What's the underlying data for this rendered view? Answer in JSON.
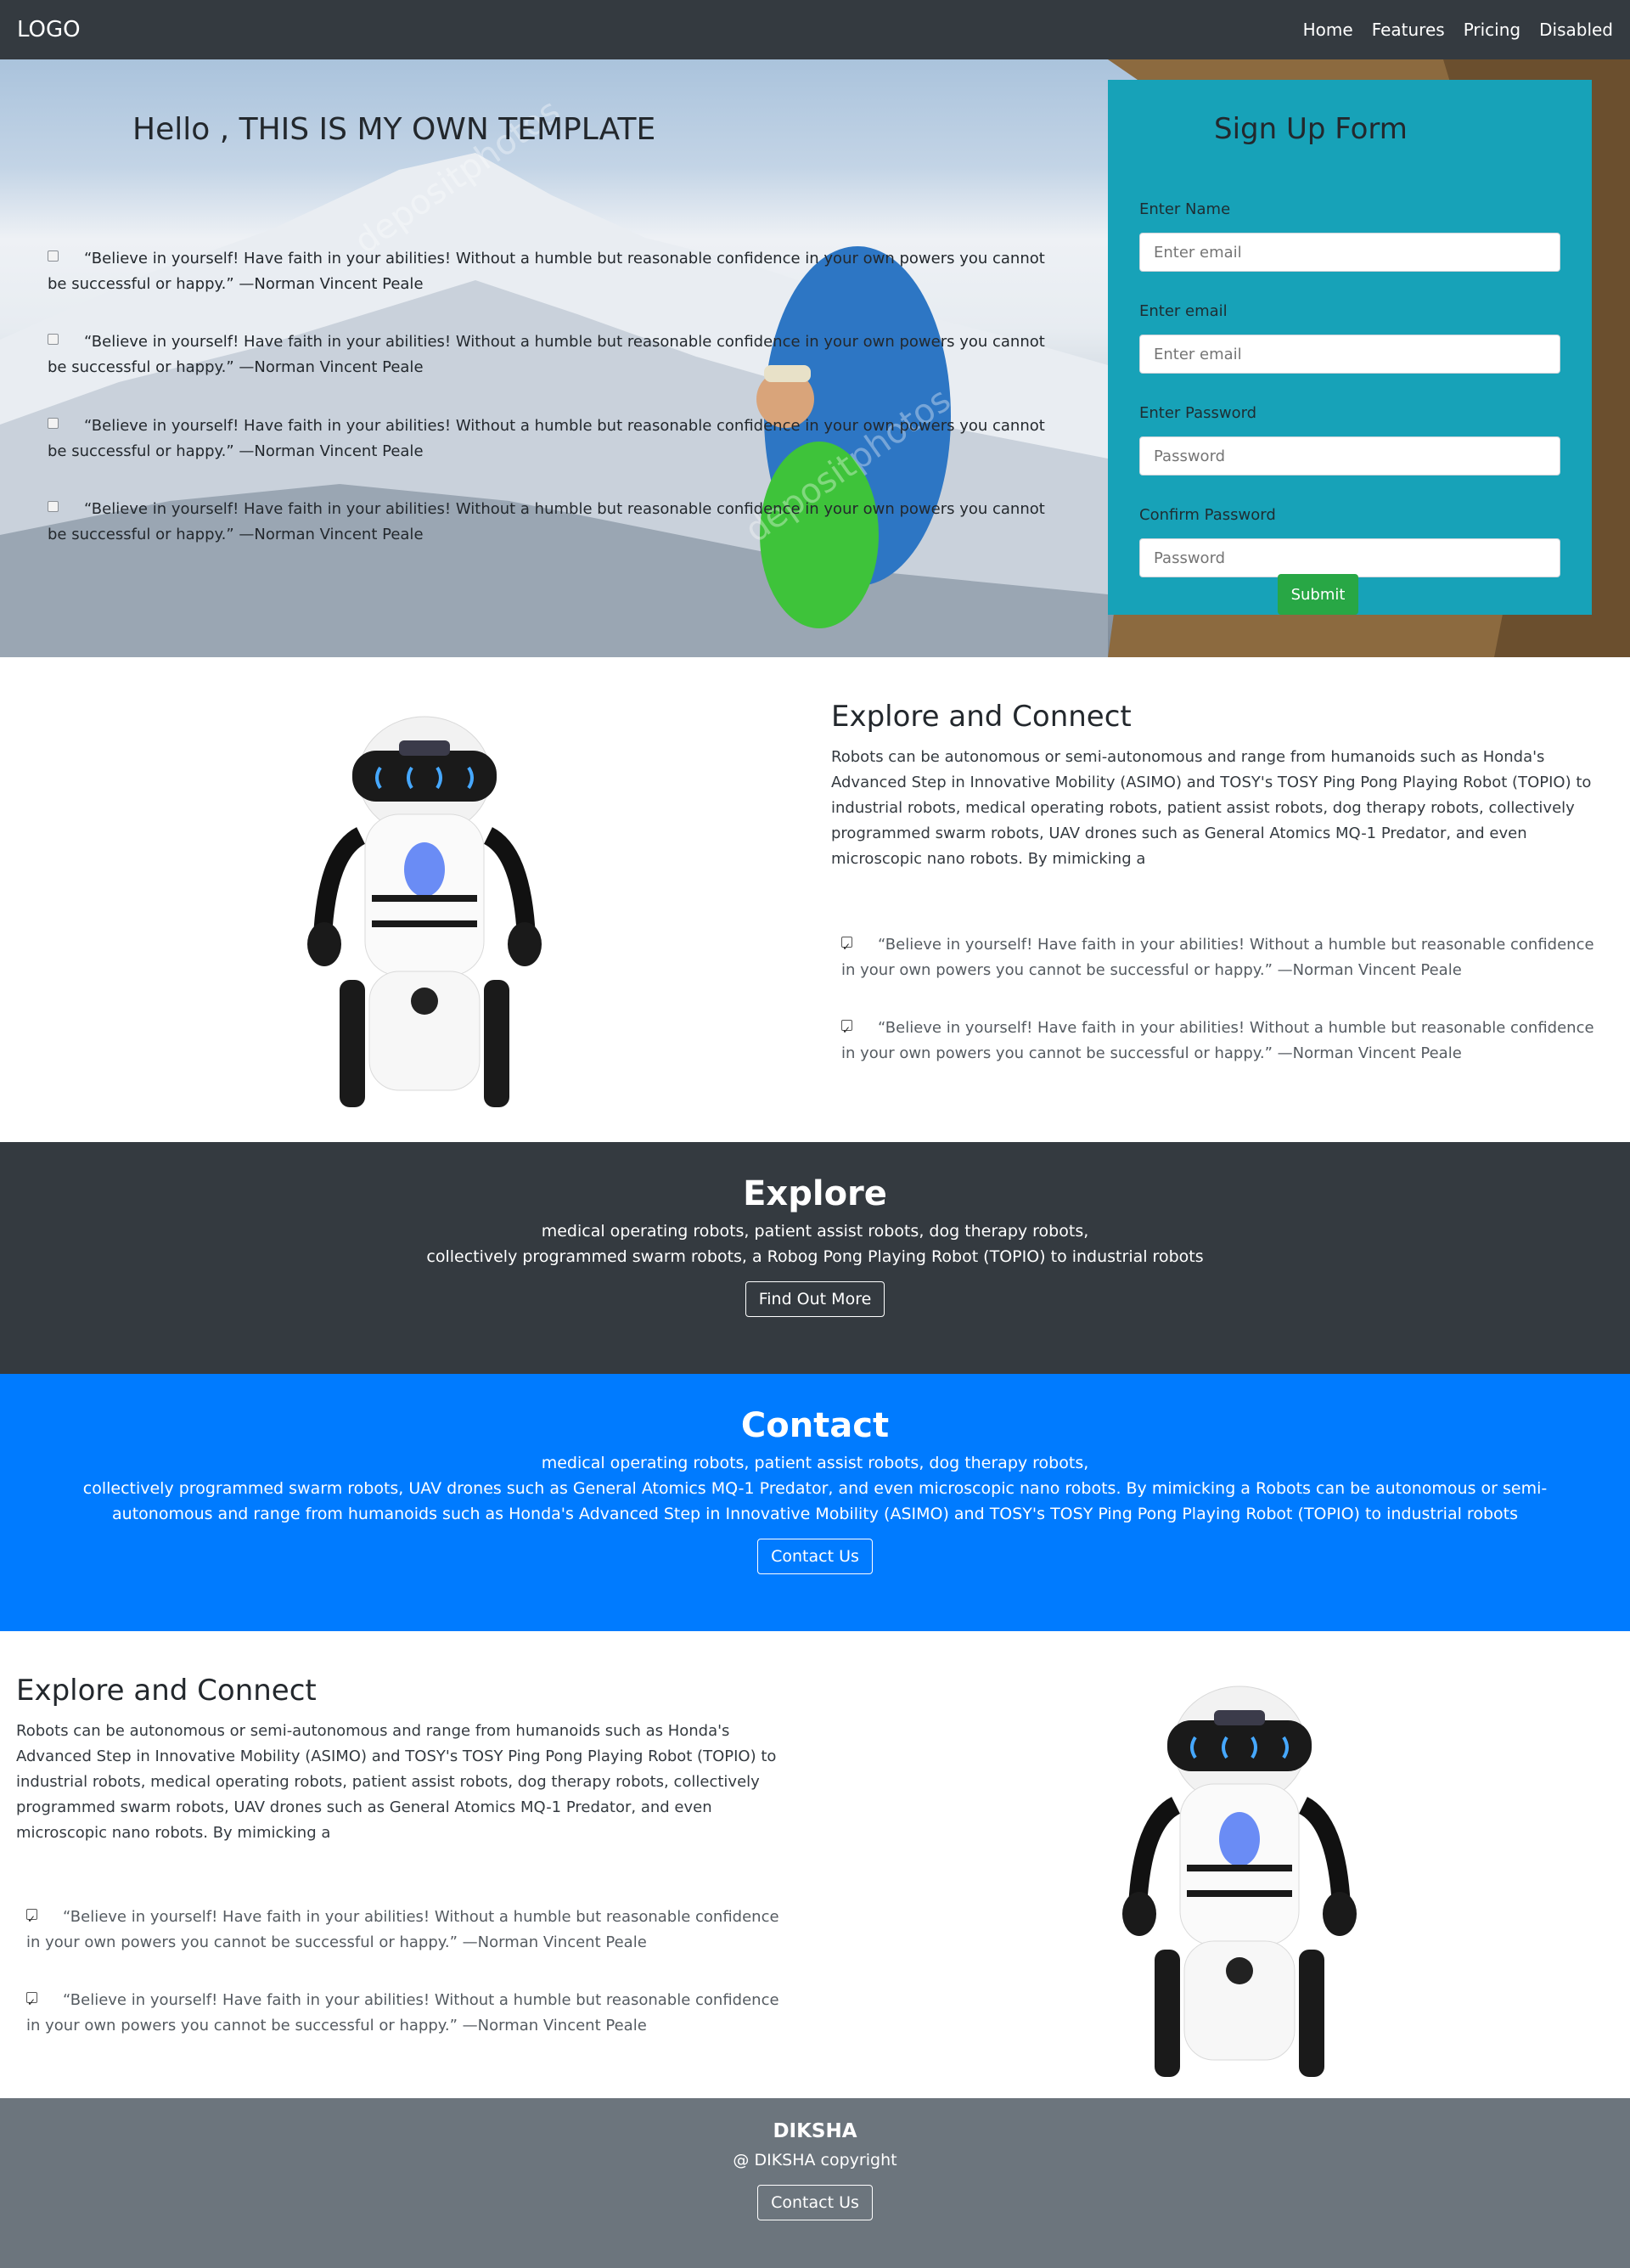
{
  "navbar": {
    "logo": "LOGO",
    "links": [
      "Home",
      "Features",
      "Pricing",
      "Disabled"
    ]
  },
  "hero": {
    "title": "Hello , THIS IS MY OWN TEMPLATE",
    "quotes": [
      "“Believe in yourself! Have faith in your abilities! Without a humble but reasonable confidence in your own powers you cannot be successful or happy.” —Norman Vincent Peale",
      "“Believe in yourself! Have faith in your abilities! Without a humble but reasonable confidence in your own powers you cannot be successful or happy.” —Norman Vincent Peale",
      "“Believe in yourself! Have faith in your abilities! Without a humble but reasonable confidence in your own powers you cannot be successful or happy.” —Norman Vincent Peale",
      "“Believe in yourself! Have faith in your abilities! Without a humble but reasonable confidence in your own powers you cannot be successful or happy.” —Norman Vincent Peale"
    ],
    "watermark": "depositphotos"
  },
  "signup": {
    "title": "Sign Up Form",
    "name_label": "Enter Name",
    "name_placeholder": "Enter email",
    "email_label": "Enter email",
    "email_placeholder": "Enter email",
    "password_label": "Enter Password",
    "password_placeholder": "Password",
    "confirm_label": "Confirm Password",
    "confirm_placeholder": "Password",
    "submit_label": "Submit"
  },
  "feature1": {
    "title": "Explore and Connect",
    "paragraph": "Robots can be autonomous or semi-autonomous and range from humanoids such as Honda's Advanced Step in Innovative Mobility (ASIMO) and TOSY's TOSY Ping Pong Playing Robot (TOPIO) to industrial robots, medical operating robots, patient assist robots, dog therapy robots, collectively programmed swarm robots, UAV drones such as General Atomics MQ-1 Predator, and even microscopic nano robots. By mimicking a",
    "quotes": [
      "“Believe in yourself! Have faith in your abilities! Without a humble but reasonable confidence in your own powers you cannot be successful or happy.” —Norman Vincent Peale",
      "“Believe in yourself! Have faith in your abilities! Without a humble but reasonable confidence in your own powers you cannot be successful or happy.” —Norman Vincent Peale"
    ]
  },
  "explore": {
    "title": "Explore",
    "line1": "medical operating robots, patient assist robots, dog therapy robots,",
    "line2": "collectively programmed swarm robots, a Robog Pong Playing Robot (TOPIO) to industrial robots",
    "button": "Find Out More"
  },
  "contact": {
    "title": "Contact",
    "line1": "medical operating robots, patient assist robots, dog therapy robots,",
    "line2": "collectively programmed swarm robots, UAV drones such as General Atomics MQ-1 Predator, and even microscopic nano robots. By mimicking a Robots can be autonomous or semi-autonomous and range from humanoids such as Honda's Advanced Step in Innovative Mobility (ASIMO) and TOSY's TOSY Ping Pong Playing Robot (TOPIO) to industrial robots",
    "button": "Contact Us"
  },
  "feature2": {
    "title": "Explore and Connect",
    "paragraph": "Robots can be autonomous or semi-autonomous and range from humanoids such as Honda's Advanced Step in Innovative Mobility (ASIMO) and TOSY's TOSY Ping Pong Playing Robot (TOPIO) to industrial robots, medical operating robots, patient assist robots, dog therapy robots, collectively programmed swarm robots, UAV drones such as General Atomics MQ-1 Predator, and even microscopic nano robots. By mimicking a",
    "quotes": [
      "“Believe in yourself! Have faith in your abilities! Without a humble but reasonable confidence in your own powers you cannot be successful or happy.” —Norman Vincent Peale",
      "“Believe in yourself! Have faith in your abilities! Without a humble but reasonable confidence in your own powers you cannot be successful or happy.” —Norman Vincent Peale"
    ]
  },
  "footer": {
    "brand": "DIKSHA",
    "copyright": "@ DIKSHA copyright",
    "button": "Contact Us"
  },
  "colors": {
    "navbar": "#343a40",
    "signup_panel": "#17a2b8",
    "submit": "#28a745",
    "explore_band": "#343a40",
    "contact_band": "#007bff",
    "footer": "#6c757d"
  }
}
